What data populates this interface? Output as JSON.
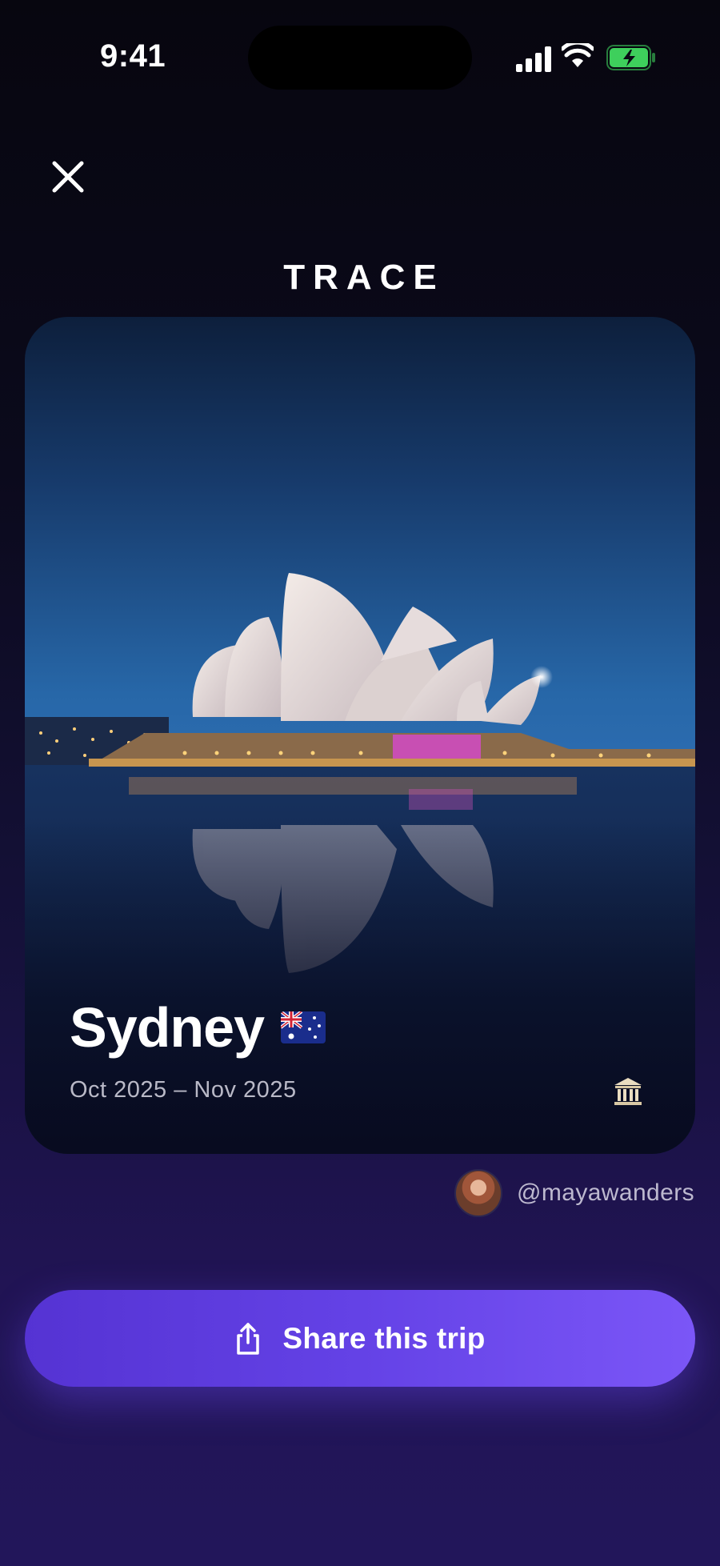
{
  "status_bar": {
    "time": "9:41",
    "icons": [
      "cellular-signal-icon",
      "wifi-icon",
      "battery-charging-icon"
    ],
    "battery_color": "#3ecf5c"
  },
  "header": {
    "close_icon": "close-icon",
    "brand": "TRACE"
  },
  "trip_card": {
    "city": "Sydney",
    "flag_icon": "australia-flag-icon",
    "dates": "Oct 2025 – Nov 2025",
    "category_icon": "landmark-icon"
  },
  "author": {
    "username": "@mayawanders",
    "avatar_icon": "avatar"
  },
  "share_button": {
    "label": "Share this trip",
    "icon": "share-icon",
    "accent_start": "#5533d3",
    "accent_end": "#7b56f7"
  }
}
